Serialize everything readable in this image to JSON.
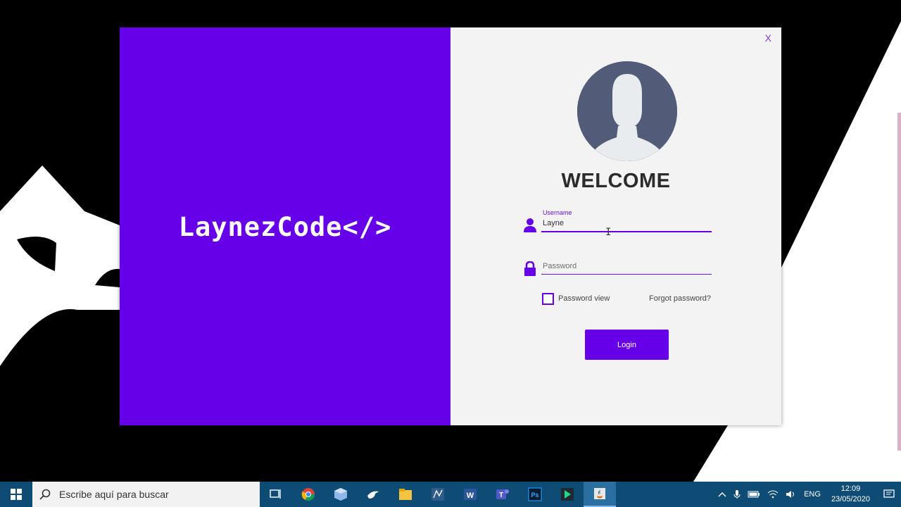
{
  "window": {
    "brand_logo": "LaynezCode</>",
    "close_label": "X",
    "welcome_title": "WELCOME",
    "username": {
      "label": "Username",
      "value": "Layne"
    },
    "password": {
      "placeholder": "Password",
      "value": ""
    },
    "password_view_label": "Password view",
    "password_view_checked": false,
    "forgot_password_label": "Forgot password?",
    "login_button_label": "Login"
  },
  "colors": {
    "brand": "#6600e8",
    "form_background": "#f3f3f3",
    "avatar_background": "#525b78",
    "taskbar": "#0f4c75"
  },
  "taskbar": {
    "search_placeholder": "Escribe aquí para buscar",
    "apps": [
      {
        "name": "task-view-icon"
      },
      {
        "name": "chrome-icon"
      },
      {
        "name": "virtualbox-icon"
      },
      {
        "name": "bird-app-icon"
      },
      {
        "name": "file-explorer-icon"
      },
      {
        "name": "netbeans-icon"
      },
      {
        "name": "word-icon"
      },
      {
        "name": "teams-icon"
      },
      {
        "name": "photoshop-icon"
      },
      {
        "name": "code-editor-icon"
      },
      {
        "name": "java-app-icon",
        "active": true
      }
    ],
    "language": "ENG",
    "time": "12:09",
    "date": "23/05/2020"
  }
}
